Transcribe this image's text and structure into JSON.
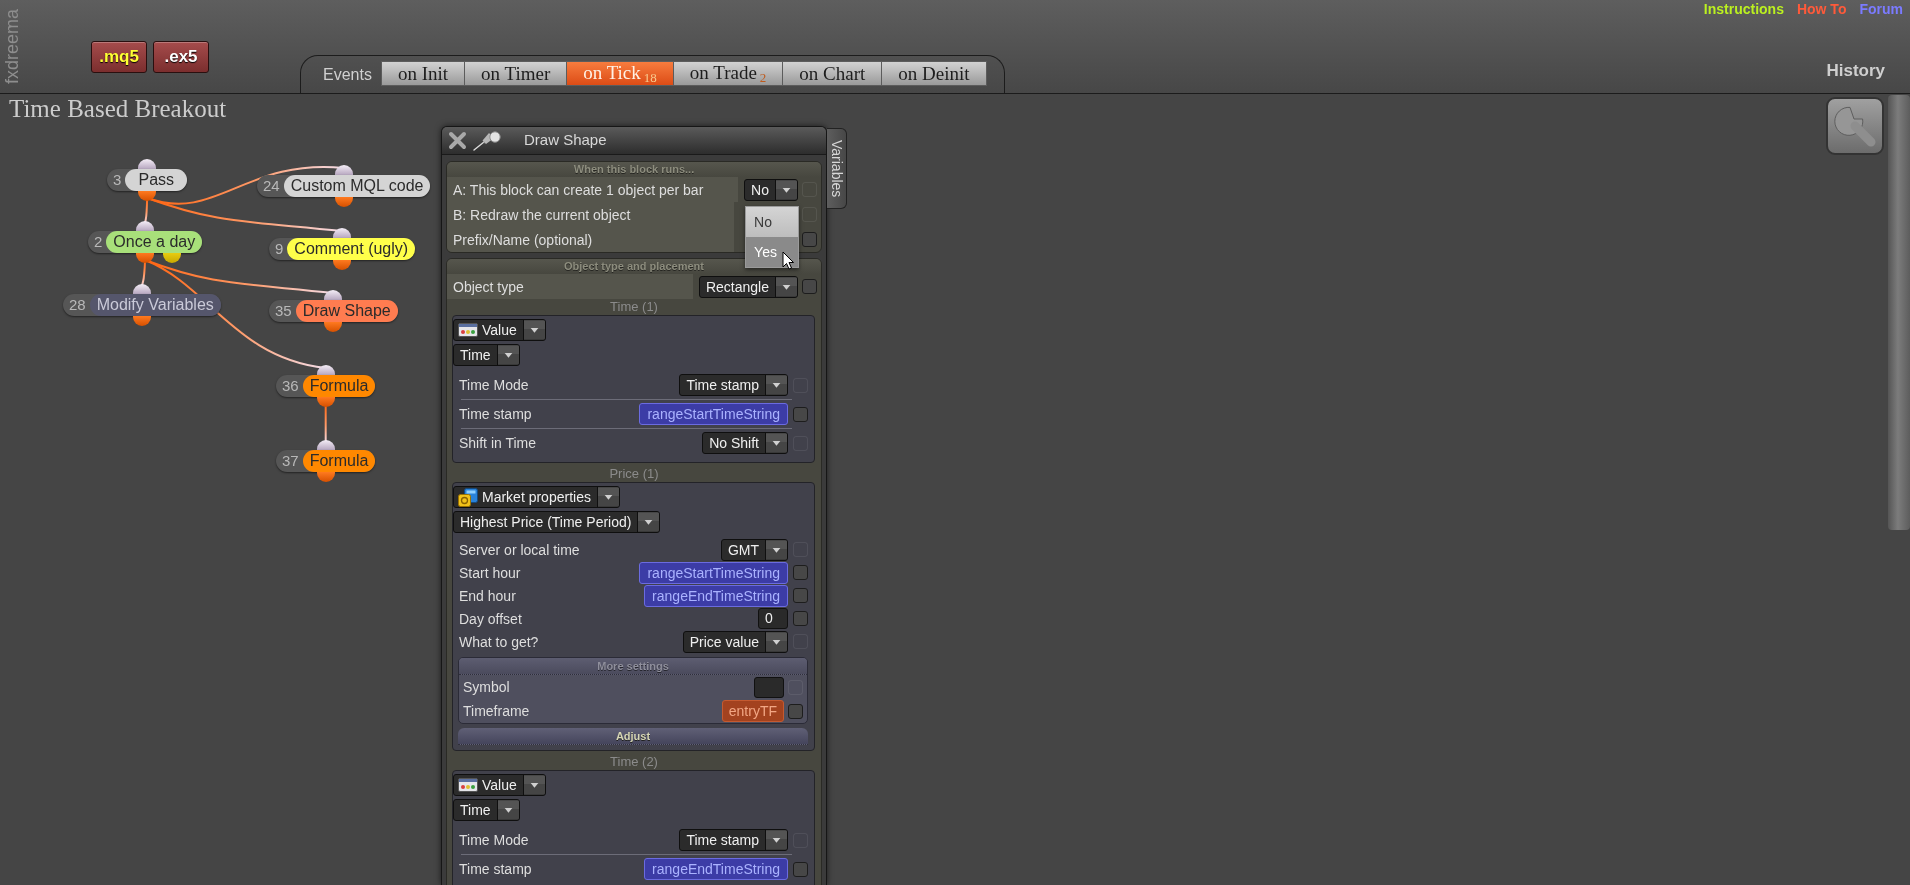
{
  "header": {
    "logo": "fxdreema",
    "file_buttons": [
      {
        "label": ".mq5",
        "kind": "source"
      },
      {
        "label": ".ex5",
        "kind": "compiled"
      }
    ],
    "links": [
      {
        "label": "Instructions",
        "color": "#bbf020"
      },
      {
        "label": "How To",
        "color": "#ff5a3a"
      },
      {
        "label": "Forum",
        "color": "#7b7bff"
      }
    ],
    "history": "History"
  },
  "events": {
    "label": "Events",
    "tabs": [
      {
        "label": "on Init",
        "selected": false
      },
      {
        "label": "on Timer",
        "selected": false
      },
      {
        "label": "on Tick",
        "count": "18",
        "selected": true
      },
      {
        "label": "on Trade",
        "count": "2",
        "selected": false
      },
      {
        "label": "on Chart",
        "selected": false
      },
      {
        "label": "on Deinit",
        "selected": false
      }
    ]
  },
  "project_title": "Time Based Breakout",
  "canvas": {
    "nodes": [
      {
        "number": "3",
        "label": "Pass",
        "color": "#d4d4d4",
        "kind": "action",
        "children": [
          {
            "number": "24",
            "label": "Custom MQL code",
            "color": "#d4d4d4",
            "kind": "action"
          },
          {
            "number": "2",
            "label": "Once a day",
            "color": "#a8e07a",
            "kind": "condition",
            "children": [
              {
                "number": "28",
                "label": "Modify Variables",
                "color": "#55566c",
                "kind": "action"
              },
              {
                "number": "35",
                "label": "Draw Shape",
                "color": "#ff7c50",
                "kind": "action"
              },
              {
                "number": "36",
                "label": "Formula",
                "color": "#ff8800",
                "kind": "action",
                "children": [
                  {
                    "number": "37",
                    "label": "Formula",
                    "color": "#ff8800",
                    "kind": "action"
                  }
                ]
              }
            ]
          },
          {
            "number": "9",
            "label": "Comment (ugly)",
            "color": "#ffff4a",
            "kind": "action"
          }
        ]
      }
    ]
  },
  "panel": {
    "title": "Draw Shape",
    "side_tab": "Variables",
    "sections": [
      {
        "title": "When this block runs...",
        "rows": [
          {
            "kind": "select",
            "label": "A: This block can create 1 object per bar",
            "value": "No",
            "checkbox": {
              "checked": false,
              "disabled": true
            },
            "dropdown": {
              "options": [
                {
                  "label": "No",
                  "selected": false
                },
                {
                  "label": "Yes",
                  "selected": true
                }
              ]
            }
          },
          {
            "kind": "covered",
            "label": "B: Redraw the current object",
            "checkbox": {
              "checked": false,
              "disabled": true
            }
          },
          {
            "kind": "covered",
            "label": "Prefix/Name (optional)",
            "checkbox": {
              "checked": false,
              "disabled": false
            }
          }
        ]
      },
      {
        "title": "Object type and placement",
        "rows": [
          {
            "kind": "select",
            "label": "Object type",
            "value": "Rectangle",
            "checkbox": {
              "checked": false,
              "disabled": false
            }
          }
        ],
        "groups": [
          {
            "caption": "Time (1)",
            "separated": true,
            "source": {
              "kind": "value",
              "label": "Value"
            },
            "mode": "Time",
            "rows": [
              {
                "kind": "select",
                "label": "Time Mode",
                "value": "Time stamp",
                "checkbox": {
                  "checked": false,
                  "disabled": true
                }
              },
              {
                "kind": "variable",
                "label": "Time stamp",
                "value": "rangeStartTimeString",
                "checkbox": {
                  "checked": false,
                  "disabled": false
                }
              },
              {
                "kind": "select",
                "label": "Shift in Time",
                "value": "No Shift",
                "checkbox": {
                  "checked": false,
                  "disabled": true
                }
              }
            ]
          },
          {
            "caption": "Price (1)",
            "separated": false,
            "source": {
              "kind": "market",
              "label": "Market properties"
            },
            "mode": "Highest Price (Time Period)",
            "rows": [
              {
                "kind": "select",
                "label": "Server or local time",
                "value": "GMT",
                "checkbox": {
                  "checked": false,
                  "disabled": true
                }
              },
              {
                "kind": "variable",
                "label": "Start hour",
                "value": "rangeStartTimeString",
                "checkbox": {
                  "checked": false,
                  "disabled": false
                }
              },
              {
                "kind": "variable",
                "label": "End hour",
                "value": "rangeEndTimeString",
                "checkbox": {
                  "checked": false,
                  "disabled": false
                }
              },
              {
                "kind": "text",
                "label": "Day offset",
                "value": "0",
                "checkbox": {
                  "checked": false,
                  "disabled": false
                }
              },
              {
                "kind": "select",
                "label": "What to get?",
                "value": "Price value",
                "checkbox": {
                  "checked": false,
                  "disabled": true
                }
              }
            ],
            "subsections": [
              {
                "title": "More settings",
                "expanded": true,
                "rows": [
                  {
                    "kind": "text",
                    "label": "Symbol",
                    "checkbox": {
                      "checked": false,
                      "disabled": true
                    }
                  },
                  {
                    "kind": "input",
                    "label": "Timeframe",
                    "value": "entryTF",
                    "checkbox": {
                      "checked": false,
                      "disabled": false
                    }
                  }
                ]
              },
              {
                "title": "Adjust",
                "expanded": false
              }
            ]
          },
          {
            "caption": "Time (2)",
            "separated": true,
            "source": {
              "kind": "value",
              "label": "Value"
            },
            "mode": "Time",
            "rows": [
              {
                "kind": "select",
                "label": "Time Mode",
                "value": "Time stamp",
                "checkbox": {
                  "checked": false,
                  "disabled": true
                }
              },
              {
                "kind": "variable",
                "label": "Time stamp",
                "value": "rangeEndTimeString",
                "checkbox": {
                  "checked": false,
                  "disabled": false
                }
              }
            ]
          }
        ]
      }
    ]
  }
}
